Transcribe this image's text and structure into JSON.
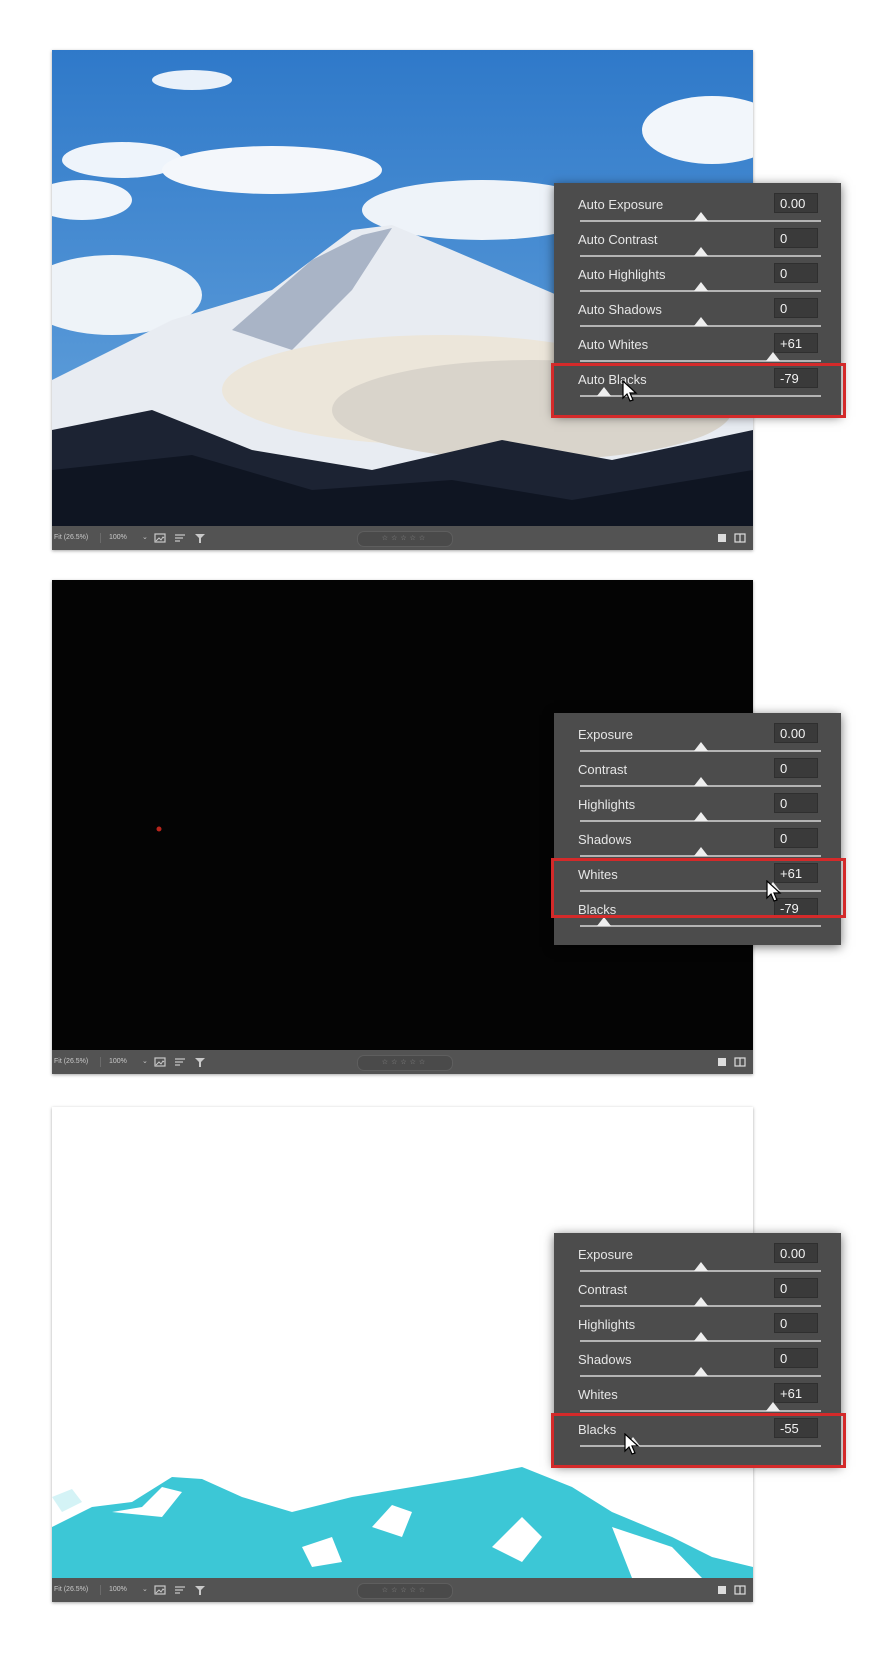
{
  "screenshots": [
    {
      "panel": {
        "rows": [
          {
            "label": "Auto Exposure",
            "value": "0.00",
            "level": 0.5
          },
          {
            "label": "Auto Contrast",
            "value": "0",
            "level": 0.5
          },
          {
            "label": "Auto Highlights",
            "value": "0",
            "level": 0.5
          },
          {
            "label": "Auto Shadows",
            "value": "0",
            "level": 0.5
          },
          {
            "label": "Auto Whites",
            "value": "+61",
            "level": 0.8
          },
          {
            "label": "Auto Blacks",
            "value": "-79",
            "level": 0.1
          }
        ],
        "highlighted_row": "Auto Blacks"
      },
      "toolbar": {
        "zoom": "Fit (26.5%)",
        "percent": "100%",
        "caret": "⌄",
        "stars": "☆☆☆☆☆"
      }
    },
    {
      "panel": {
        "rows": [
          {
            "label": "Exposure",
            "value": "0.00",
            "level": 0.5
          },
          {
            "label": "Contrast",
            "value": "0",
            "level": 0.5
          },
          {
            "label": "Highlights",
            "value": "0",
            "level": 0.5
          },
          {
            "label": "Shadows",
            "value": "0",
            "level": 0.5
          },
          {
            "label": "Whites",
            "value": "+61",
            "level": 0.8
          },
          {
            "label": "Blacks",
            "value": "-79",
            "level": 0.1
          }
        ],
        "highlighted_row": "Whites"
      },
      "toolbar": {
        "zoom": "Fit (26.5%)",
        "percent": "100%",
        "caret": "⌄",
        "stars": "☆☆☆☆☆"
      }
    },
    {
      "panel": {
        "rows": [
          {
            "label": "Exposure",
            "value": "0.00",
            "level": 0.5
          },
          {
            "label": "Contrast",
            "value": "0",
            "level": 0.5
          },
          {
            "label": "Highlights",
            "value": "0",
            "level": 0.5
          },
          {
            "label": "Shadows",
            "value": "0",
            "level": 0.5
          },
          {
            "label": "Whites",
            "value": "+61",
            "level": 0.8
          },
          {
            "label": "Blacks",
            "value": "-55",
            "level": 0.22
          }
        ],
        "highlighted_row": "Blacks"
      },
      "toolbar": {
        "zoom": "Fit (26.5%)",
        "percent": "100%",
        "caret": "⌄",
        "stars": "☆☆☆☆☆"
      }
    }
  ],
  "colors": {
    "highlight": "#d42a2a",
    "panel_bg": "#4c4c4c",
    "toolbar_bg": "#535353",
    "clipping_overlay": "#3cc7d6"
  },
  "icons": [
    "image-view-icon",
    "sort-icon",
    "filter-icon",
    "single-view-icon",
    "compare-view-icon",
    "pointer-cursor-icon"
  ]
}
